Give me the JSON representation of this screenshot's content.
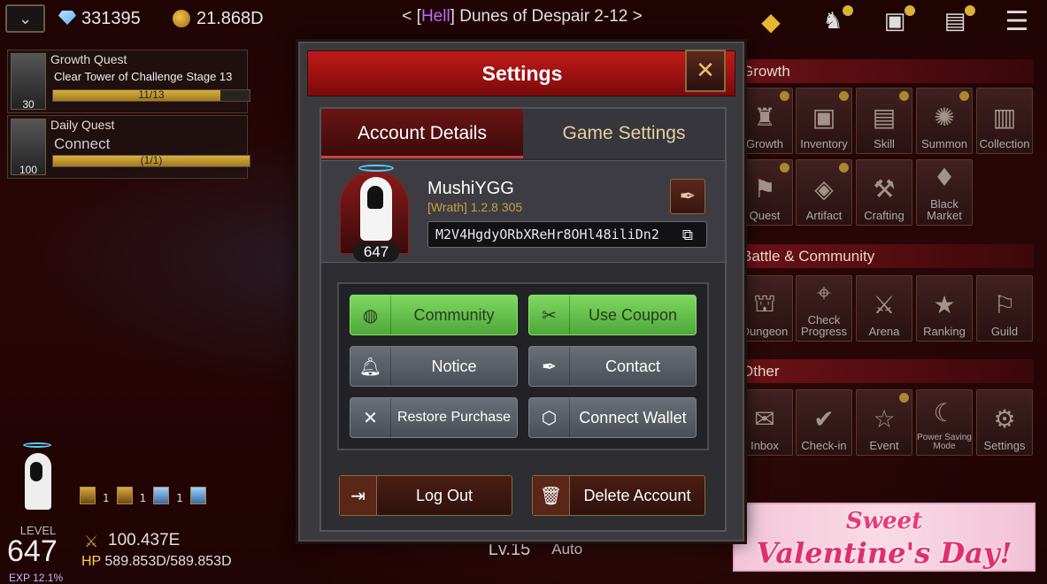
{
  "currency": {
    "gems": "331395",
    "gold": "21.868D"
  },
  "stage": {
    "prefix": "< [",
    "difficulty": "Hell",
    "name": "] Dunes of Despair 2-12 >"
  },
  "quests": [
    {
      "title": "Growth Quest",
      "text": "Clear Tower of Challenge Stage 13",
      "progress": "11/13",
      "fill": 0.85,
      "level": "30"
    },
    {
      "title": "Daily Quest",
      "text": "Connect",
      "progress": "(1/1)",
      "fill": 1.0,
      "level": "100"
    }
  ],
  "sections": {
    "growth": "Growth",
    "battle": "Battle & Community",
    "other": "Other"
  },
  "growth_menu": [
    "Growth",
    "Inventory",
    "Skill",
    "Summon",
    "Collection",
    "Quest",
    "Artifact",
    "Crafting",
    "Black Market"
  ],
  "battle_menu": [
    "Dungeon",
    "Check Progress",
    "Arena",
    "Ranking",
    "Guild"
  ],
  "other_menu": [
    "Inbox",
    "Check-in",
    "Event",
    "Power Saving Mode",
    "Settings"
  ],
  "player": {
    "level_label": "LEVEL",
    "level": "647",
    "power": "100.437E",
    "hp_label": "HP",
    "hp": "589.853D/589.853D",
    "exp": "EXP 12.1%",
    "buff_count": "1"
  },
  "bottom_center": {
    "level": "Lv.15",
    "auto": "Auto"
  },
  "banner": {
    "line1": "Sweet",
    "line2": "Valentine's Day!"
  },
  "dialog": {
    "title": "Settings",
    "tabs": [
      "Account Details",
      "Game Settings"
    ],
    "account": {
      "username": "MushiYGG",
      "version": "[Wrath] 1.2.8 305",
      "uid": "M2V4HgdyORbXReHr8OHl48iliDn2",
      "avatar_level": "647"
    },
    "buttons": [
      {
        "label": "Community",
        "style": "green",
        "icon": "globe-icon"
      },
      {
        "label": "Use Coupon",
        "style": "green",
        "icon": "ticket-icon"
      },
      {
        "label": "Notice",
        "style": "gray",
        "icon": "bell-icon"
      },
      {
        "label": "Contact",
        "style": "gray",
        "icon": "quill-icon"
      },
      {
        "label": "Restore Purchase",
        "style": "gray",
        "icon": "tools-icon"
      },
      {
        "label": "Connect Wallet",
        "style": "gray",
        "icon": "wallet-icon"
      }
    ],
    "logout": "Log Out",
    "delete": "Delete Account"
  },
  "colors": {
    "accent_red": "#c21a1a",
    "green_btn": "#6cc44e",
    "gold": "#d8b23a"
  }
}
